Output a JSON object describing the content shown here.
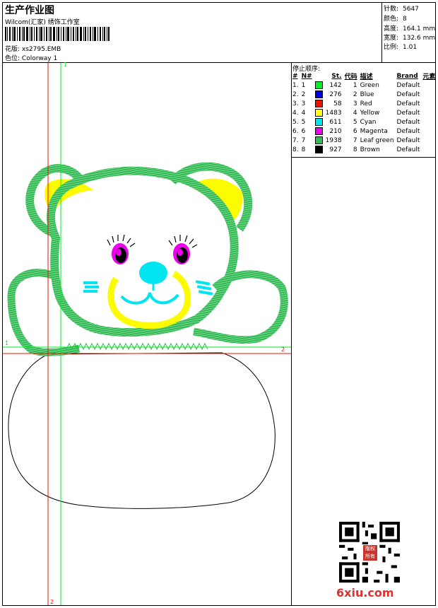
{
  "header": {
    "title": "生产作业图",
    "company": "Wilcom(汇家) 绣饰工作室",
    "pattern_label": "花版:",
    "pattern_value": "xs2795.EMB",
    "colorway_label": "色位:",
    "colorway_value": "Colorway 1"
  },
  "specs": [
    {
      "label": "针数:",
      "value": "5647"
    },
    {
      "label": "颜色:",
      "value": "8"
    },
    {
      "label": "高度:",
      "value": "164.1 mm"
    },
    {
      "label": "宽度:",
      "value": "132.6 mm"
    },
    {
      "label": "比例:",
      "value": "1.01"
    }
  ],
  "stop_sequence": {
    "title": "停止顺序:",
    "headers": [
      "#",
      "N#",
      "",
      "St.",
      "代码",
      "描述",
      "Brand",
      "元素"
    ],
    "rows": [
      {
        "idx": "1.",
        "n": "1",
        "color": "#00ee22",
        "st": "142",
        "code": "1",
        "desc": "Green",
        "brand": "Default"
      },
      {
        "idx": "2.",
        "n": "2",
        "color": "#0000ee",
        "st": "276",
        "code": "2",
        "desc": "Blue",
        "brand": "Default"
      },
      {
        "idx": "3.",
        "n": "3",
        "color": "#ee1100",
        "st": "58",
        "code": "3",
        "desc": "Red",
        "brand": "Default"
      },
      {
        "idx": "4.",
        "n": "4",
        "color": "#ffff00",
        "st": "1483",
        "code": "4",
        "desc": "Yellow",
        "brand": "Default"
      },
      {
        "idx": "5.",
        "n": "5",
        "color": "#00e5f0",
        "st": "611",
        "code": "5",
        "desc": "Cyan",
        "brand": "Default"
      },
      {
        "idx": "6.",
        "n": "6",
        "color": "#ee00ee",
        "st": "210",
        "code": "6",
        "desc": "Magenta",
        "brand": "Default"
      },
      {
        "idx": "7.",
        "n": "7",
        "color": "#33bb55",
        "st": "1938",
        "code": "7",
        "desc": "Leaf green",
        "brand": "Default"
      },
      {
        "idx": "8.",
        "n": "8",
        "color": "#000000",
        "st": "927",
        "code": "8",
        "desc": "Brown",
        "brand": "Default"
      }
    ]
  },
  "guides": {
    "v1_top": "1",
    "h1_left": "1",
    "h2_right": "2",
    "v2_bottom": "2"
  },
  "watermark": {
    "site": "6xiu.com",
    "seal": "版权所有"
  },
  "colors": {
    "leaf_green": "#33bb55",
    "yellow": "#ffff00",
    "cyan": "#00e5f0",
    "magenta": "#ee00ee",
    "guide_red": "#ee1100",
    "guide_green": "#00ee22"
  }
}
